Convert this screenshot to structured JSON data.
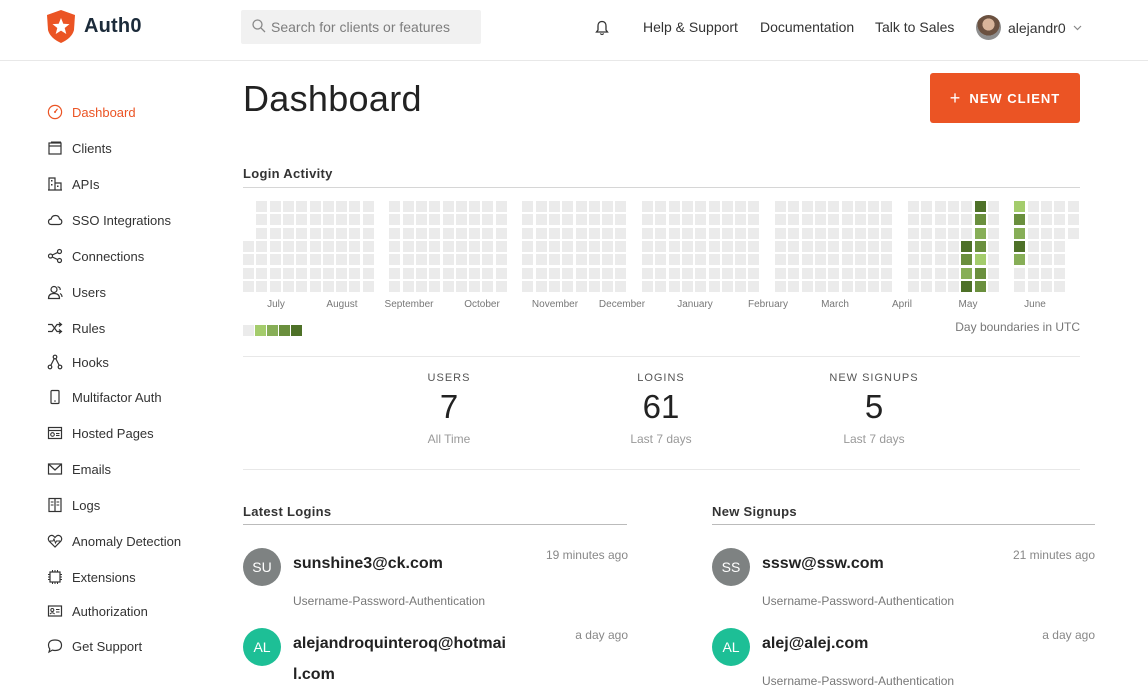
{
  "header": {
    "logo_text": "Auth0",
    "search_placeholder": "Search for clients or features",
    "nav": [
      "Help & Support",
      "Documentation",
      "Talk to Sales"
    ],
    "user_name": "alejandr0"
  },
  "sidebar": {
    "items": [
      {
        "label": "Dashboard",
        "icon": "speedometer-icon",
        "active": true
      },
      {
        "label": "Clients",
        "icon": "window-icon"
      },
      {
        "label": "APIs",
        "icon": "building-icon"
      },
      {
        "label": "SSO Integrations",
        "icon": "cloud-icon"
      },
      {
        "label": "Connections",
        "icon": "share-nodes-icon"
      },
      {
        "label": "Users",
        "icon": "users-icon"
      },
      {
        "label": "Rules",
        "icon": "shuffle-icon"
      },
      {
        "label": "Hooks",
        "icon": "hook-nodes-icon"
      },
      {
        "label": "Multifactor Auth",
        "icon": "phone-icon"
      },
      {
        "label": "Hosted Pages",
        "icon": "browser-icon"
      },
      {
        "label": "Emails",
        "icon": "envelope-icon"
      },
      {
        "label": "Logs",
        "icon": "book-icon"
      },
      {
        "label": "Anomaly Detection",
        "icon": "heartbeat-icon"
      },
      {
        "label": "Extensions",
        "icon": "chip-icon"
      },
      {
        "label": "Authorization",
        "icon": "id-card-icon"
      },
      {
        "label": "Get Support",
        "icon": "chat-bubble-icon"
      }
    ]
  },
  "main": {
    "title": "Dashboard",
    "new_client_label": "NEW CLIENT",
    "login_activity": {
      "title": "Login Activity",
      "months": [
        "July",
        "August",
        "September",
        "October",
        "November",
        "December",
        "January",
        "February",
        "March",
        "April",
        "May",
        "June"
      ],
      "note": "Day boundaries in UTC",
      "colors": [
        "#ebebeb",
        "#a4cc6c",
        "#87ae57",
        "#6a8f3d",
        "#4e7128"
      ]
    },
    "stats": [
      {
        "label": "USERS",
        "value": "7",
        "sub": "All Time"
      },
      {
        "label": "LOGINS",
        "value": "61",
        "sub": "Last 7 days"
      },
      {
        "label": "NEW SIGNUPS",
        "value": "5",
        "sub": "Last 7 days"
      }
    ],
    "latest_logins": {
      "title": "Latest Logins",
      "items": [
        {
          "initials": "SU",
          "email": "sunshine3@ck.com",
          "time": "19 minutes ago",
          "connection": "Username-Password-Authentication",
          "color": "#7e8282"
        },
        {
          "initials": "AL",
          "email": "alejandroquinteroq@hotmail.com",
          "time": "a day ago",
          "connection": "",
          "color": "#1dbf96"
        }
      ]
    },
    "new_signups": {
      "title": "New Signups",
      "items": [
        {
          "initials": "SS",
          "email": "sssw@ssw.com",
          "time": "21 minutes ago",
          "connection": "Username-Password-Authentication",
          "color": "#7e8282"
        },
        {
          "initials": "AL",
          "email": "alej@alej.com",
          "time": "a day ago",
          "connection": "Username-Password-Authentication",
          "color": "#1dbf96"
        }
      ]
    }
  }
}
